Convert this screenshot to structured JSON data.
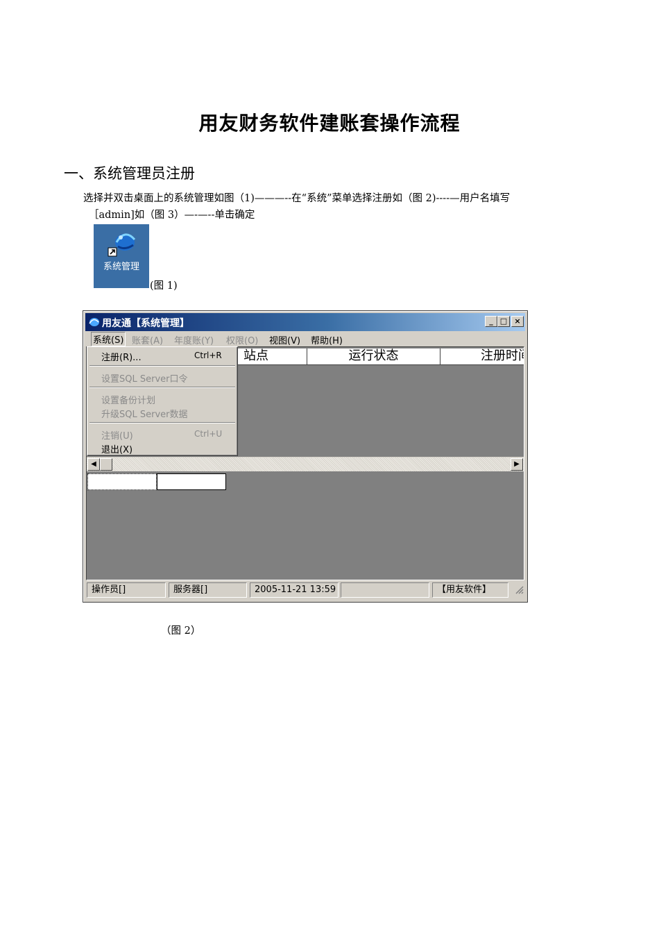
{
  "document": {
    "title": "用友财务软件建账套操作流程",
    "section_heading": "一、系统管理员注册",
    "paragraph_line1": "选择并双击桌面上的系统管理如图（1)———--在“系统”菜单选择注册如（图 2)----—用户名填写",
    "paragraph_line2": "［admin]如（图 3）—-—--单击确定",
    "fig1_caption": "(图 1)",
    "fig2_caption": "（图 2）"
  },
  "desktop_icon": {
    "label": "系统管理",
    "icon": "system-management-icon"
  },
  "window": {
    "title": "用友通【系统管理】",
    "title_buttons": [
      "_",
      "□",
      "×"
    ],
    "menu": [
      {
        "label": "系统(S)",
        "state": "active"
      },
      {
        "label": "账套(A)",
        "state": "disabled"
      },
      {
        "label": "年度账(Y)",
        "state": "disabled"
      },
      {
        "label": "权限(O)",
        "state": "disabled"
      },
      {
        "label": "视图(V)",
        "state": "enabled"
      },
      {
        "label": "帮助(H)",
        "state": "enabled"
      }
    ],
    "dropdown": [
      {
        "label": "注册(R)...",
        "shortcut": "Ctrl+R",
        "disabled": false
      },
      {
        "label": "设置SQL Server口令",
        "shortcut": "",
        "disabled": true
      },
      {
        "label": "设置备份计划",
        "shortcut": "",
        "disabled": true
      },
      {
        "label": "升级SQL Server数据",
        "shortcut": "",
        "disabled": true
      },
      {
        "label": "注销(U)",
        "shortcut": "Ctrl+U",
        "disabled": true
      },
      {
        "label": "退出(X)",
        "shortcut": "",
        "disabled": false
      }
    ],
    "columns": [
      "站点",
      "运行状态",
      "注册时间"
    ],
    "status": {
      "operator": "操作员[]",
      "server": "服务器[]",
      "datetime": "2005-11-21  13:59",
      "empty": "",
      "brand": "【用友软件】"
    }
  }
}
